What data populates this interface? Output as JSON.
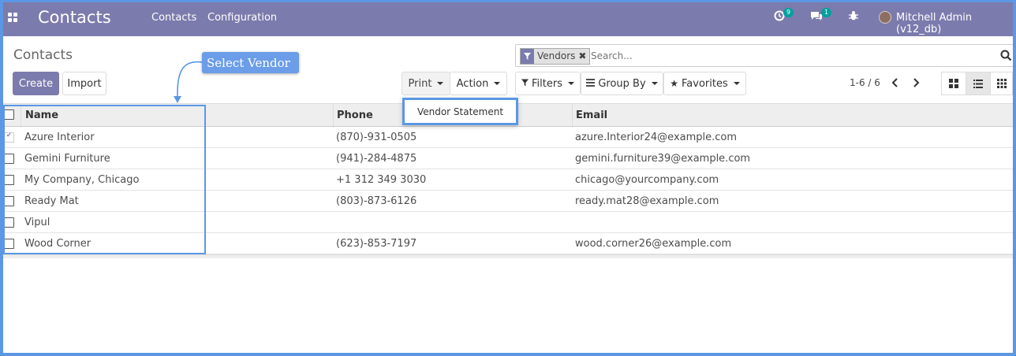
{
  "navbar": {
    "brand": "Contacts",
    "menu": [
      "Contacts",
      "Configuration"
    ],
    "activity_count": "9",
    "message_count": "1",
    "user": "Mitchell Admin (v12_db)"
  },
  "control_panel": {
    "breadcrumb": "Contacts",
    "create_label": "Create",
    "import_label": "Import",
    "print_label": "Print",
    "action_label": "Action",
    "filters_label": "Filters",
    "groupby_label": "Group By",
    "favorites_label": "Favorites",
    "pager": "1-6 / 6"
  },
  "search": {
    "facet": "Vendors",
    "placeholder": "Search..."
  },
  "print_menu": {
    "items": [
      "Vendor Statement"
    ]
  },
  "table": {
    "columns": [
      "Name",
      "Phone",
      "Email"
    ],
    "rows": [
      {
        "name": "Azure Interior",
        "phone": "(870)-931-0505",
        "email": "azure.Interior24@example.com",
        "checked": true
      },
      {
        "name": "Gemini Furniture",
        "phone": "(941)-284-4875",
        "email": "gemini.furniture39@example.com",
        "checked": false
      },
      {
        "name": "My Company, Chicago",
        "phone": "+1 312 349 3030",
        "email": "chicago@yourcompany.com",
        "checked": false
      },
      {
        "name": "Ready Mat",
        "phone": "(803)-873-6126",
        "email": "ready.mat28@example.com",
        "checked": false
      },
      {
        "name": "Vipul",
        "phone": "",
        "email": "",
        "checked": false
      },
      {
        "name": "Wood Corner",
        "phone": "(623)-853-7197",
        "email": "wood.corner26@example.com",
        "checked": false
      }
    ]
  },
  "annotation": {
    "callout": "Select Vendor"
  },
  "colors": {
    "brand": "#7c7bad",
    "annotation": "#5b97e4",
    "badge": "#00a09d"
  }
}
